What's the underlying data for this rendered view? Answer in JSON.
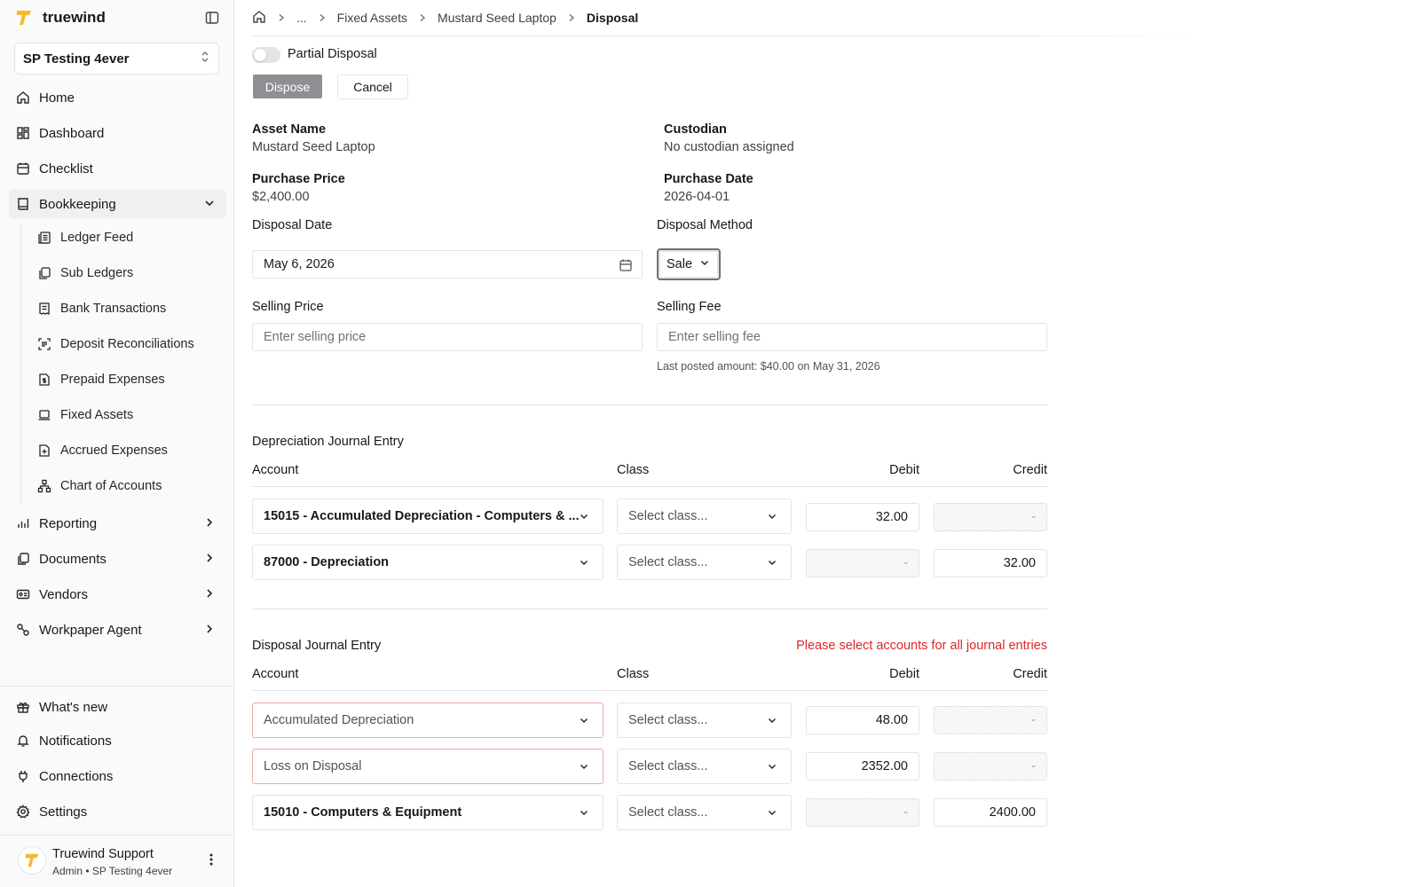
{
  "sidebar": {
    "brand": "truewind",
    "org": "SP Testing 4ever",
    "nav": [
      {
        "label": "Home",
        "icon": "home-icon"
      },
      {
        "label": "Dashboard",
        "icon": "dashboard-icon"
      },
      {
        "label": "Checklist",
        "icon": "calendar-icon"
      },
      {
        "label": "Bookkeeping",
        "icon": "book-icon"
      }
    ],
    "bookkeeping_items": [
      {
        "label": "Ledger Feed",
        "icon": "ledger-icon"
      },
      {
        "label": "Sub Ledgers",
        "icon": "copy-icon"
      },
      {
        "label": "Bank Transactions",
        "icon": "receipt-icon"
      },
      {
        "label": "Deposit Reconciliations",
        "icon": "scan-icon"
      },
      {
        "label": "Prepaid Expenses",
        "icon": "file-dollar-icon"
      },
      {
        "label": "Fixed Assets",
        "icon": "laptop-icon"
      },
      {
        "label": "Accrued Expenses",
        "icon": "file-plus-icon"
      },
      {
        "label": "Chart of Accounts",
        "icon": "hierarchy-icon"
      }
    ],
    "nav_more": [
      {
        "label": "Reporting",
        "icon": "chart-icon"
      },
      {
        "label": "Documents",
        "icon": "documents-icon"
      },
      {
        "label": "Vendors",
        "icon": "vendors-icon"
      },
      {
        "label": "Workpaper Agent",
        "icon": "agent-icon"
      }
    ],
    "footer": [
      {
        "label": "What's new",
        "icon": "gift-icon"
      },
      {
        "label": "Notifications",
        "icon": "bell-icon"
      },
      {
        "label": "Connections",
        "icon": "plug-icon"
      },
      {
        "label": "Settings",
        "icon": "gear-icon"
      }
    ],
    "user": {
      "name": "Truewind Support",
      "role": "Admin • SP Testing 4ever"
    }
  },
  "breadcrumb": {
    "ellipsis": "...",
    "items": [
      "Fixed Assets",
      "Mustard Seed Laptop"
    ],
    "current": "Disposal"
  },
  "form": {
    "partial_label": "Partial Disposal",
    "partial_enabled": false,
    "dispose_label": "Dispose",
    "cancel_label": "Cancel",
    "asset_name_label": "Asset Name",
    "asset_name": "Mustard Seed Laptop",
    "custodian_label": "Custodian",
    "custodian": "No custodian assigned",
    "purchase_price_label": "Purchase Price",
    "purchase_price": "$2,400.00",
    "purchase_date_label": "Purchase Date",
    "purchase_date": "2026-04-01",
    "disposal_date_label": "Disposal Date",
    "disposal_date": "May 6, 2026",
    "disposal_method_label": "Disposal Method",
    "disposal_method": "Sale",
    "selling_price_label": "Selling Price",
    "selling_price_placeholder": "Enter selling price",
    "selling_fee_label": "Selling Fee",
    "selling_fee_placeholder": "Enter selling fee",
    "selling_fee_helper": "Last posted amount: $40.00 on May 31, 2026"
  },
  "columns": {
    "account": "Account",
    "class": "Class",
    "debit": "Debit",
    "credit": "Credit",
    "class_placeholder": "Select class...",
    "empty": "-"
  },
  "depreciation": {
    "title": "Depreciation Journal Entry",
    "rows": [
      {
        "account": "15015 - Accumulated Depreciation - Computers & ...",
        "debit": "32.00",
        "credit": "-"
      },
      {
        "account": "87000 - Depreciation",
        "debit": "-",
        "credit": "32.00"
      }
    ]
  },
  "disposal": {
    "title": "Disposal Journal Entry",
    "error": "Please select accounts for all journal entries",
    "rows": [
      {
        "account": "Accumulated Depreciation",
        "debit": "48.00",
        "credit": "-"
      },
      {
        "account": "Loss on Disposal",
        "debit": "2352.00",
        "credit": "-"
      },
      {
        "account": "15010 - Computers & Equipment",
        "debit": "-",
        "credit": "2400.00"
      }
    ]
  },
  "colors": {
    "accent": "#f5b82e",
    "error": "#dc2626",
    "border": "#e4e4e7"
  }
}
